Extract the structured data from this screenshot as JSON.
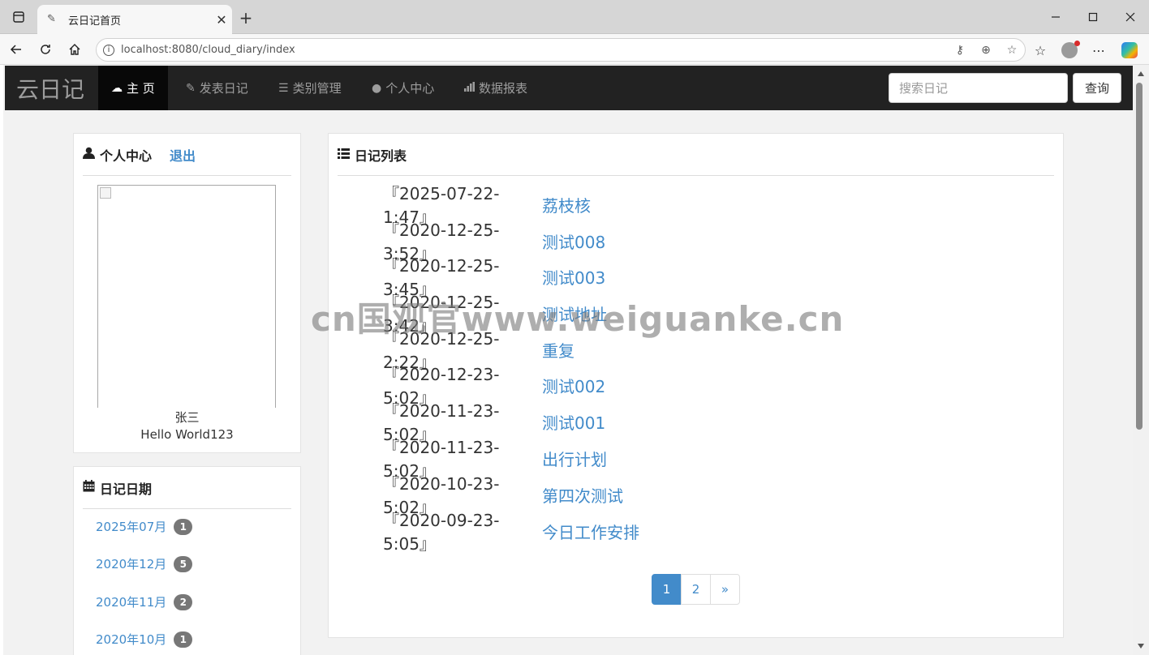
{
  "browser": {
    "tab_title": "云日记首页",
    "url": "localhost:8080/cloud_diary/index"
  },
  "navbar": {
    "brand": "云日记",
    "items": [
      {
        "label": "主 页",
        "icon": "cloud-icon",
        "active": true
      },
      {
        "label": "发表日记",
        "icon": "pencil-icon",
        "active": false
      },
      {
        "label": "类别管理",
        "icon": "list-icon",
        "active": false
      },
      {
        "label": "个人中心",
        "icon": "user-icon",
        "active": false
      },
      {
        "label": "数据报表",
        "icon": "signal-icon",
        "active": false
      }
    ],
    "search_placeholder": "搜索日记",
    "search_button": "查询"
  },
  "profile": {
    "title": "个人中心",
    "logout": "退出",
    "name": "张三",
    "signature": "Hello World123"
  },
  "dates": {
    "title": "日记日期",
    "items": [
      {
        "label": "2025年07月",
        "count": "1"
      },
      {
        "label": "2020年12月",
        "count": "5"
      },
      {
        "label": "2020年11月",
        "count": "2"
      },
      {
        "label": "2020年10月",
        "count": "1"
      }
    ]
  },
  "diary": {
    "title": "日记列表",
    "entries": [
      {
        "date": "『2025-07-22-1:47』",
        "title": "荔枝核"
      },
      {
        "date": "『2020-12-25-3:52』",
        "title": "测试008"
      },
      {
        "date": "『2020-12-25-3:45』",
        "title": "测试003"
      },
      {
        "date": "『2020-12-25-3:42』",
        "title": "测试地址"
      },
      {
        "date": "『2020-12-25-2:22』",
        "title": "重复"
      },
      {
        "date": "『2020-12-23-5:02』",
        "title": "测试002"
      },
      {
        "date": "『2020-11-23-5:02』",
        "title": "测试001"
      },
      {
        "date": "『2020-11-23-5:02』",
        "title": "出行计划"
      },
      {
        "date": "『2020-10-23-5:02』",
        "title": "第四次测试"
      },
      {
        "date": "『2020-09-23-5:05』",
        "title": "今日工作安排"
      }
    ],
    "pages": [
      "1",
      "2",
      "»"
    ],
    "current_page": "1"
  },
  "watermark": "cn国观官www.weiguanke.cn"
}
